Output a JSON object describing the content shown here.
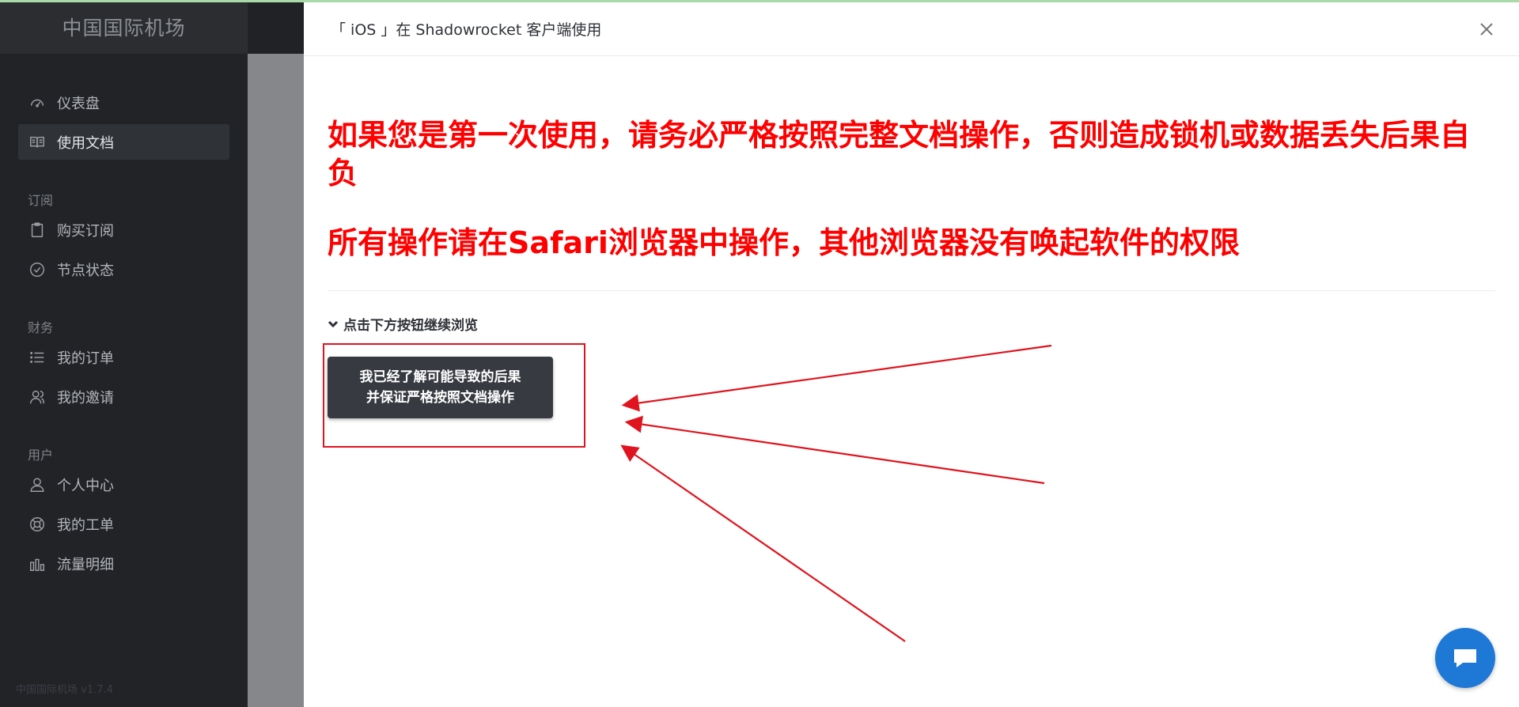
{
  "sidebar": {
    "brand": "中国国际机场",
    "items_main": [
      {
        "label": "仪表盘",
        "icon": "dashboard-icon"
      },
      {
        "label": "使用文档",
        "icon": "book-icon",
        "active": true
      }
    ],
    "groups": [
      {
        "title": "订阅",
        "items": [
          {
            "label": "购买订阅",
            "icon": "clipboard-icon"
          },
          {
            "label": "节点状态",
            "icon": "check-circle-icon"
          }
        ]
      },
      {
        "title": "财务",
        "items": [
          {
            "label": "我的订单",
            "icon": "list-icon"
          },
          {
            "label": "我的邀请",
            "icon": "users-icon"
          }
        ]
      },
      {
        "title": "用户",
        "items": [
          {
            "label": "个人中心",
            "icon": "user-icon"
          },
          {
            "label": "我的工单",
            "icon": "lifebuoy-icon"
          },
          {
            "label": "流量明细",
            "icon": "bar-chart-icon"
          }
        ]
      }
    ],
    "version": "中国国际机场 v1.7.4"
  },
  "drawer": {
    "title": "「 iOS 」在 Shadowrocket 客户端使用",
    "warning_1": "如果您是第一次使用，请务必严格按照完整文档操作，否则造成锁机或数据丢失后果自负",
    "warning_2": "所有操作请在Safari浏览器中操作，其他浏览器没有唤起软件的权限",
    "collapse_label": "点击下方按钮继续浏览",
    "confirm_line1": "我已经了解可能导致的后果",
    "confirm_line2": "并保证严格按照文档操作"
  },
  "colors": {
    "warning": "#ff0000",
    "annotation": "#e0141e",
    "chat": "#1e78d6",
    "sidebar_bg": "#212327"
  }
}
